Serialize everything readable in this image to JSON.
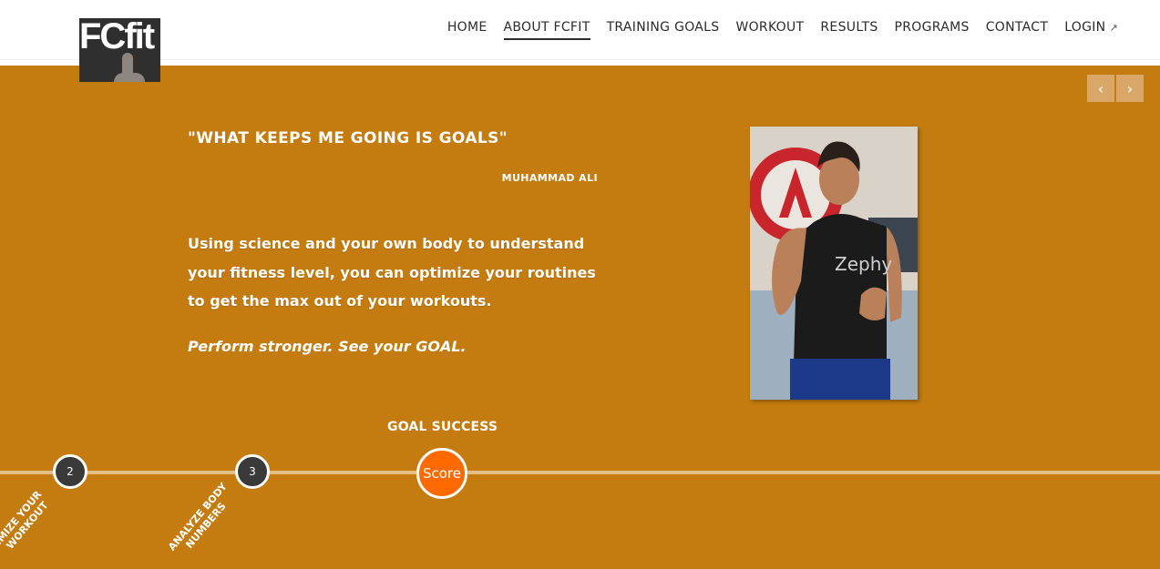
{
  "logo": {
    "text": "FCfit"
  },
  "nav": {
    "items": [
      {
        "label": "HOME",
        "active": false
      },
      {
        "label": "ABOUT FCFIT",
        "active": true
      },
      {
        "label": "TRAINING GOALS",
        "active": false
      },
      {
        "label": "WORKOUT",
        "active": false
      },
      {
        "label": "RESULTS",
        "active": false
      },
      {
        "label": "PROGRAMS",
        "active": false
      },
      {
        "label": "CONTACT",
        "active": false
      },
      {
        "label": "LOGIN",
        "active": false,
        "icon": "external-link-icon"
      }
    ]
  },
  "slider": {
    "prev_icon": "chevron-left-icon",
    "next_icon": "chevron-right-icon",
    "prev_glyph": "‹",
    "next_glyph": "›"
  },
  "hero": {
    "quote": "\"WHAT KEEPS ME GOING IS GOALS\"",
    "author": "MUHAMMAD ALI",
    "body": "Using science and your own body to understand your fitness level, you can optimize your routines to get the max out of your workouts.",
    "tagline": "Perform stronger. See your GOAL.",
    "photo_shirt_text": "Zephy"
  },
  "timeline": {
    "goal_label": "GOAL SUCCESS",
    "steps": [
      {
        "number": "2",
        "label": "IMIZE YOUR\nWORKOUT"
      },
      {
        "number": "3",
        "label": "ANALYZE BODY\nNUMBERS"
      }
    ],
    "score_label": "Score"
  },
  "colors": {
    "hero_bg": "#c47b0f",
    "score": "#ff6a00",
    "step": "#3a3a3a",
    "timeline": "#e5be86",
    "arrow_btn": "#d9a868"
  }
}
